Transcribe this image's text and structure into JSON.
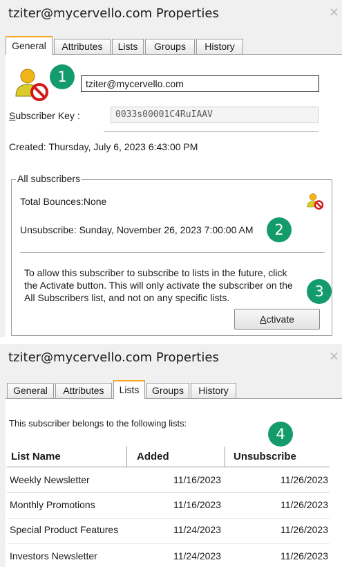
{
  "window1": {
    "title": "tziter@mycervello.com Properties",
    "tabs": [
      "General",
      "Attributes",
      "Lists",
      "Groups",
      "History"
    ],
    "active_tab": "General",
    "email_value": "tziter@mycervello.com",
    "subscriber_key_label": "Subscriber Key :",
    "subscriber_key_value": "0033s00001C4RuIAAV",
    "created_text": "Created: Thursday, July 6, 2023 6:43:00 PM",
    "group_title": "All subscribers",
    "total_bounces": "Total Bounces:None",
    "unsubscribe_text": "Unsubscribe: Sunday, November 26, 2023 7:00:00 AM",
    "info_lines": [
      "To allow this subscriber to subscribe to lists in the future, click",
      "the Activate button. This will only activate the subscriber on the",
      "All Subscribers list, and not on any specific lists."
    ],
    "activate_label": "Activate"
  },
  "window2": {
    "title": "tziter@mycervello.com Properties",
    "tabs": [
      "General",
      "Attributes",
      "Lists",
      "Groups",
      "History"
    ],
    "active_tab": "Lists",
    "intro": "This subscriber belongs to the following lists:",
    "columns": [
      "List Name",
      "Added",
      "Unsubscribe"
    ],
    "rows": [
      {
        "name": "Weekly Newsletter",
        "added": "11/16/2023",
        "unsubscribe": "11/26/2023"
      },
      {
        "name": "Monthly Promotions",
        "added": "11/16/2023",
        "unsubscribe": "11/26/2023"
      },
      {
        "name": "Special Product Features",
        "added": "11/24/2023",
        "unsubscribe": "11/26/2023"
      },
      {
        "name": "Investors Newsletter",
        "added": "11/24/2023",
        "unsubscribe": "11/26/2023"
      }
    ]
  },
  "callouts": [
    "1",
    "2",
    "3",
    "4"
  ],
  "colors": {
    "callout": "#149b6b",
    "active_tab_accent": "#f5a623"
  },
  "icons": {
    "subscriber": "unsubscribed-user-icon",
    "close": "close-icon"
  }
}
